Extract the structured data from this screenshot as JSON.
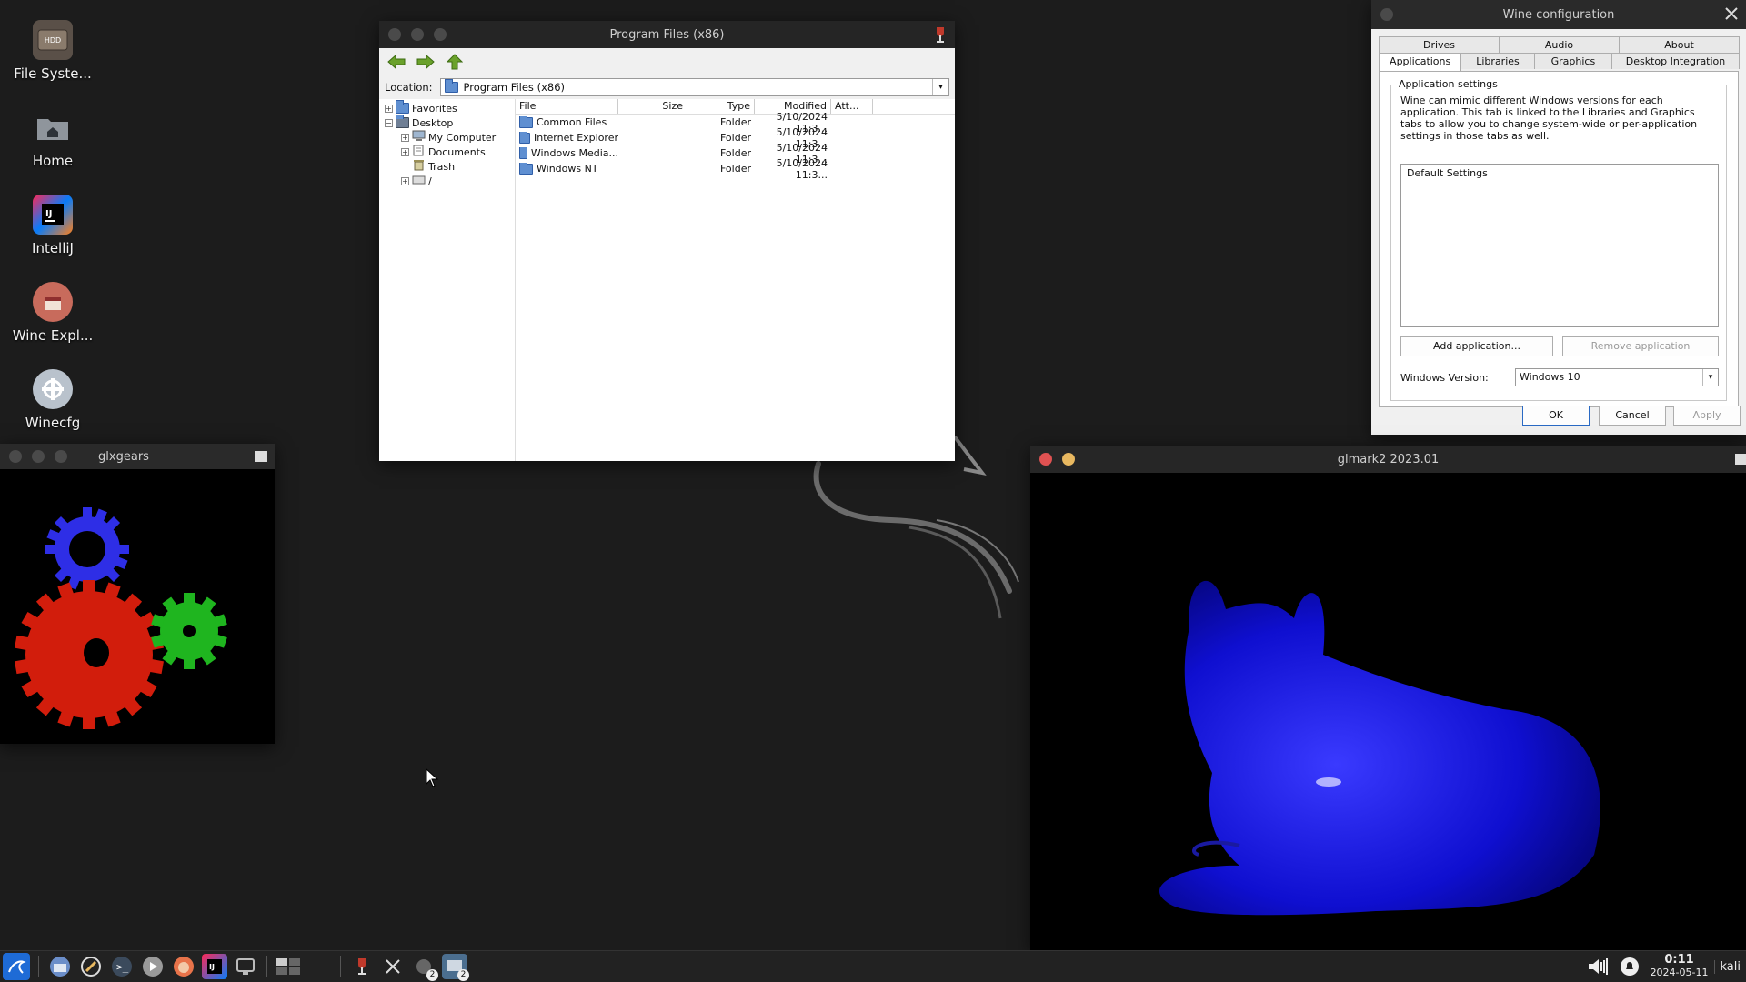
{
  "desktop": {
    "icons": [
      {
        "label": "File Syste...",
        "icon": "hdd-icon"
      },
      {
        "label": "Home",
        "icon": "home-folder-icon"
      },
      {
        "label": "IntelliJ",
        "icon": "intellij-icon"
      },
      {
        "label": "Wine Expl...",
        "icon": "wine-explorer-icon"
      },
      {
        "label": "Winecfg",
        "icon": "winecfg-icon"
      }
    ]
  },
  "explorer": {
    "title": "Program Files (x86)",
    "location_label": "Location:",
    "location_value": "Program Files (x86)",
    "tree": [
      {
        "label": "Favorites",
        "expander": "+"
      },
      {
        "label": "Desktop",
        "expander": "−"
      },
      {
        "label": "My Computer",
        "expander": "+"
      },
      {
        "label": "Documents",
        "expander": "+"
      },
      {
        "label": "Trash",
        "expander": ""
      },
      {
        "label": "/",
        "expander": "+"
      }
    ],
    "columns": [
      "File",
      "Size",
      "Type",
      "Modified",
      "Att..."
    ],
    "files": [
      {
        "name": "Common Files",
        "size": "",
        "type": "Folder",
        "modified": "5/10/2024 11:3..."
      },
      {
        "name": "Internet Explorer",
        "size": "",
        "type": "Folder",
        "modified": "5/10/2024 11:3..."
      },
      {
        "name": "Windows Media...",
        "size": "",
        "type": "Folder",
        "modified": "5/10/2024 11:3..."
      },
      {
        "name": "Windows NT",
        "size": "",
        "type": "Folder",
        "modified": "5/10/2024 11:3..."
      }
    ]
  },
  "winecfg": {
    "title": "Wine configuration",
    "tabs_top": [
      "Drives",
      "Audio",
      "About"
    ],
    "tabs_bottom": [
      "Applications",
      "Libraries",
      "Graphics",
      "Desktop Integration"
    ],
    "active_tab": "Applications",
    "group_title": "Application settings",
    "description": "Wine can mimic different Windows versions for each application. This tab is linked to the Libraries and Graphics tabs to allow you to change system-wide or per-application settings in those tabs as well.",
    "app_list": [
      "Default Settings"
    ],
    "add_button": "Add application...",
    "remove_button": "Remove application",
    "version_label": "Windows Version:",
    "version_value": "Windows 10",
    "ok": "OK",
    "cancel": "Cancel",
    "apply": "Apply"
  },
  "glxgears": {
    "title": "glxgears"
  },
  "glmark": {
    "title": "glmark2 2023.01"
  },
  "taskbar": {
    "badges": [
      "2",
      "2"
    ],
    "time": "0:11",
    "date": "2024-05-11",
    "user": "kali"
  }
}
